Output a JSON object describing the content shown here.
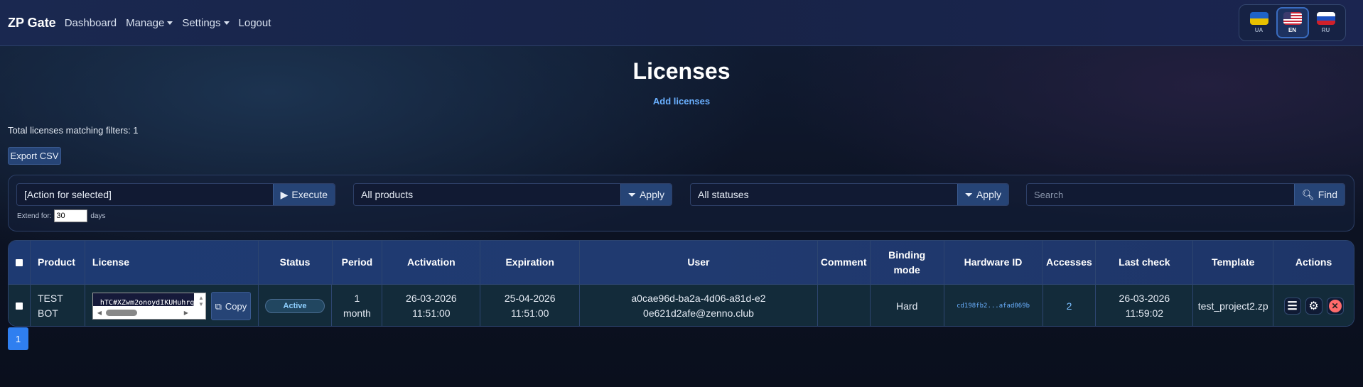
{
  "nav": {
    "brand": "ZP Gate",
    "items": [
      {
        "label": "Dashboard"
      },
      {
        "label": "Manage"
      },
      {
        "label": "Settings"
      },
      {
        "label": "Logout"
      }
    ]
  },
  "languages": [
    {
      "code": "UA",
      "active": false
    },
    {
      "code": "EN",
      "active": true
    },
    {
      "code": "RU",
      "active": false
    }
  ],
  "page": {
    "title": "Licenses",
    "add_link": "Add licenses",
    "total": "Total licenses matching filters: 1",
    "export_label": "Export CSV"
  },
  "filters": {
    "action": {
      "value": "[Action for selected]",
      "button": "Execute"
    },
    "product": {
      "value": "All products",
      "button": "Apply"
    },
    "status": {
      "value": "All statuses",
      "button": "Apply"
    },
    "search": {
      "placeholder": "Search",
      "button": "Find"
    },
    "extend_label": "Extend for:",
    "extend_value": "30",
    "extend_unit": "days"
  },
  "table": {
    "headers": [
      "Product",
      "License",
      "Status",
      "Period",
      "Activation",
      "Expiration",
      "User",
      "Comment",
      "Binding mode",
      "Hardware ID",
      "Accesses",
      "Last check",
      "Template",
      "Actions"
    ],
    "rows": [
      {
        "product": "TEST BOT",
        "license": "hTC#XZwm2onoydIKUHuhrq",
        "copy_label": "Copy",
        "status": "Active",
        "period": "1 month",
        "activation_date": "26-03-2026",
        "activation_time": "11:51:00",
        "expiration_date": "25-04-2026",
        "expiration_time": "11:51:00",
        "user": "a0cae96d-ba2a-4d06-a81d-e20e621d2afe@zenno.club",
        "comment": "",
        "binding_mode": "Hard",
        "hardware_id": "cd198fb2...afad069b",
        "accesses": "2",
        "last_check_date": "26-03-2026",
        "last_check_time": "11:59:02",
        "template": "test_project2.zp"
      }
    ]
  },
  "pagination": {
    "current": "1"
  },
  "colors": {
    "accent": "#2f7ff0",
    "link": "#6ab0ff",
    "button": "#264476",
    "danger": "#ff6b6b"
  }
}
